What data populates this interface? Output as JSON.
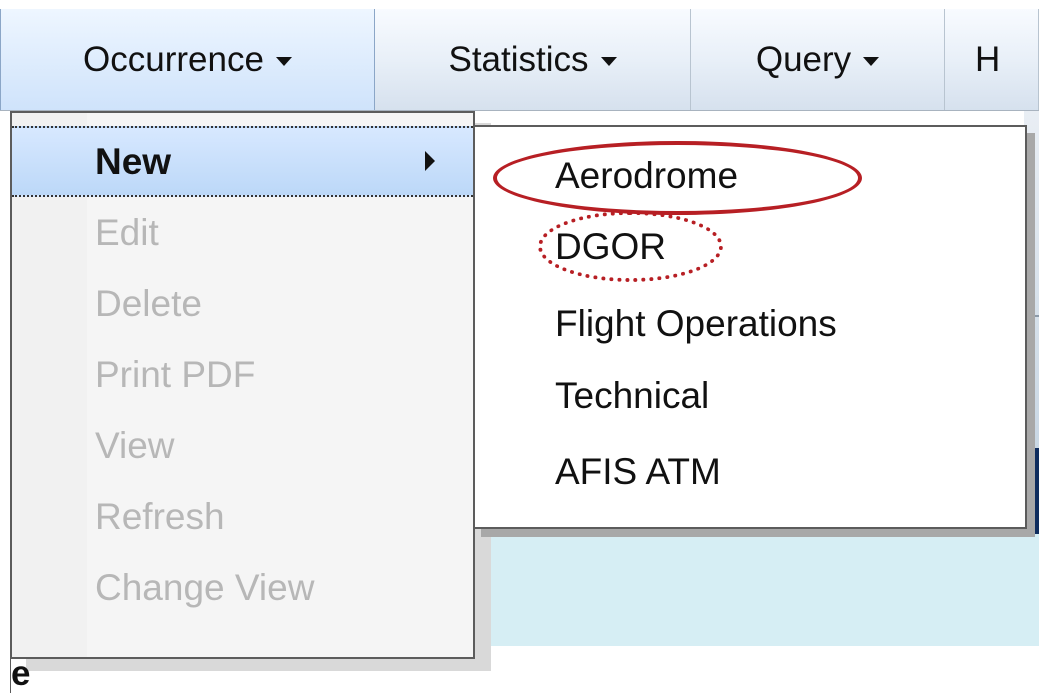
{
  "menubar": {
    "items": [
      {
        "label": "Occurrence",
        "has_arrow": true
      },
      {
        "label": "Statistics",
        "has_arrow": true
      },
      {
        "label": "Query",
        "has_arrow": true
      },
      {
        "label": "H",
        "has_arrow": false
      }
    ]
  },
  "occurrence_menu": {
    "items": [
      {
        "label": "New"
      },
      {
        "label": "Edit"
      },
      {
        "label": "Delete"
      },
      {
        "label": "Print PDF"
      },
      {
        "label": "View"
      },
      {
        "label": "Refresh"
      },
      {
        "label": "Change View"
      }
    ]
  },
  "new_submenu": {
    "items": [
      {
        "label": "Aerodrome"
      },
      {
        "label": "DGOR"
      },
      {
        "label": "Flight Operations"
      },
      {
        "label": "Technical"
      },
      {
        "label": "AFIS ATM"
      }
    ]
  },
  "background": {
    "bottom_left_text": "e"
  },
  "colors": {
    "callout": "#b71f24",
    "selected": "#bcd8f8",
    "dark_band": "#0f2d5e",
    "light_band": "#d6eef4"
  }
}
